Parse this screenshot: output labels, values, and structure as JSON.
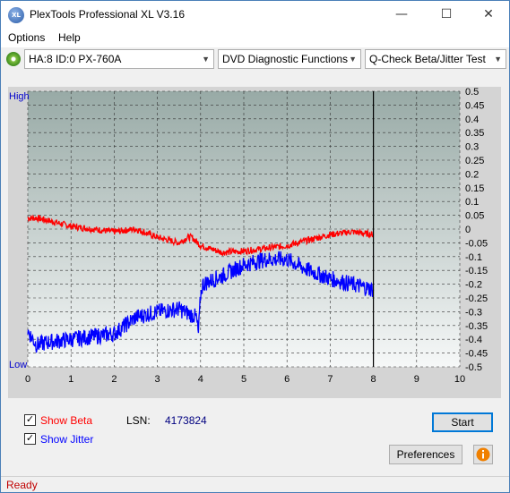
{
  "window": {
    "title": "PlexTools Professional XL V3.16",
    "app_icon_text": "XL",
    "minimize": "—",
    "maximize": "☐",
    "close": "✕"
  },
  "menu": {
    "options": "Options",
    "help": "Help"
  },
  "toolbar": {
    "drive": "HA:8 ID:0  PX-760A",
    "function": "DVD Diagnostic Functions",
    "test": "Q-Check Beta/Jitter Test"
  },
  "chart_data": {
    "type": "line",
    "title": "",
    "left_axis_labels": {
      "top": "High",
      "bottom": "Low"
    },
    "x_ticks": [
      0,
      1,
      2,
      3,
      4,
      5,
      6,
      7,
      8,
      9,
      10
    ],
    "xlim": [
      0,
      10
    ],
    "ylim": [
      -0.5,
      0.5
    ],
    "y_ticks": [
      "0.5",
      "0.45",
      "0.4",
      "0.35",
      "0.3",
      "0.25",
      "0.2",
      "0.15",
      "0.1",
      "0.05",
      "0",
      "-0.05",
      "-0.1",
      "-0.15",
      "-0.2",
      "-0.25",
      "-0.3",
      "-0.35",
      "-0.4",
      "-0.45",
      "-0.5"
    ],
    "end_marker_x": 8,
    "grid": true,
    "background_gradient": [
      "#98aaa6",
      "#f6f8f8"
    ],
    "series": [
      {
        "color": "#ff0000",
        "x": [
          0,
          0.2,
          0.5,
          1,
          1.5,
          2,
          2.5,
          3,
          3.5,
          3.7,
          3.8,
          4,
          4.5,
          5,
          5.5,
          6,
          6.5,
          7,
          7.5,
          8
        ],
        "values": [
          0.04,
          0.04,
          0.03,
          0.01,
          0.0,
          -0.01,
          0.0,
          -0.03,
          -0.05,
          -0.03,
          -0.03,
          -0.06,
          -0.085,
          -0.08,
          -0.07,
          -0.06,
          -0.04,
          -0.02,
          -0.01,
          -0.02
        ]
      },
      {
        "color": "#0000ff",
        "x": [
          0,
          0.2,
          0.5,
          1,
          1.5,
          2,
          2.5,
          3,
          3.5,
          3.9,
          3.95,
          4.0,
          4.05,
          4.5,
          5,
          5.5,
          6,
          6.5,
          7,
          7.5,
          8
        ],
        "values": [
          -0.37,
          -0.42,
          -0.41,
          -0.4,
          -0.39,
          -0.38,
          -0.32,
          -0.3,
          -0.29,
          -0.32,
          -0.38,
          -0.24,
          -0.2,
          -0.17,
          -0.13,
          -0.11,
          -0.11,
          -0.15,
          -0.18,
          -0.2,
          -0.22
        ]
      }
    ]
  },
  "controls": {
    "show_beta_label": "Show Beta",
    "show_jitter_label": "Show Jitter",
    "show_beta_checked": true,
    "show_jitter_checked": true,
    "lsn_label": "LSN:",
    "lsn_value": "4173824",
    "start_button": "Start",
    "preferences_button": "Preferences",
    "info_icon": "info-icon",
    "beta_color": "#ff0000",
    "jitter_color": "#0000ff"
  },
  "status": {
    "text": "Ready"
  }
}
